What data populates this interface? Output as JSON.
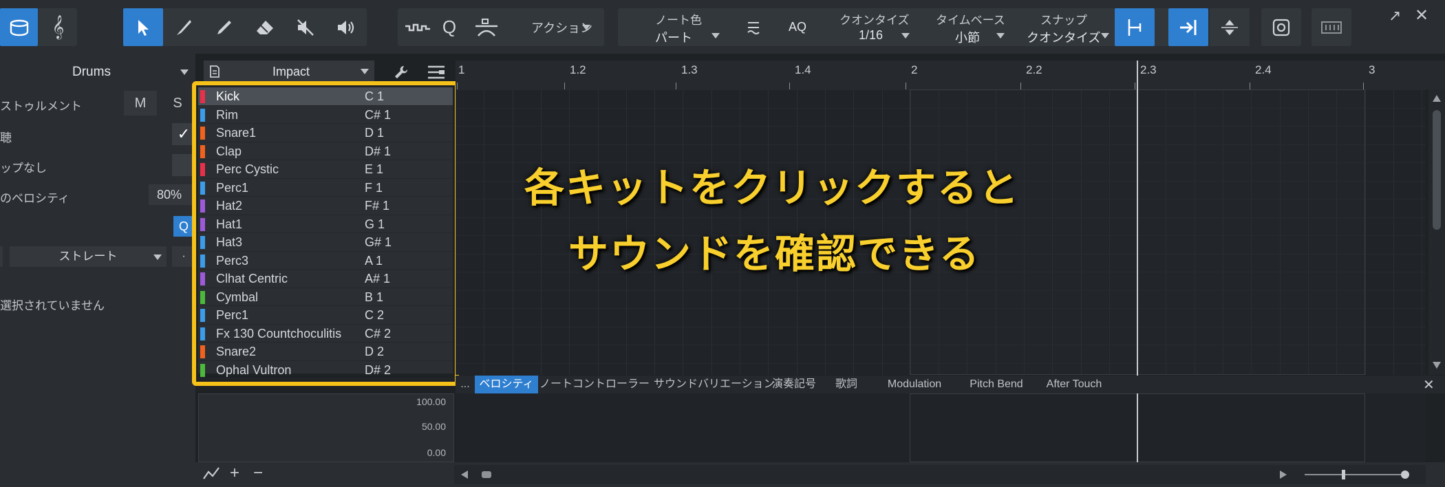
{
  "toolbar": {
    "action_label": "アクション",
    "note_color_label": "ノート色",
    "note_color_value": "パート",
    "aq_label": "AQ",
    "quantize_label": "クオンタイズ",
    "quantize_value": "1/16",
    "timebase_label": "タイムベース",
    "timebase_value": "小節",
    "snap_label": "スナップ",
    "snap_value": "クオンタイズ"
  },
  "inspector": {
    "track_name": "Drums",
    "instrument_name": "Impact",
    "instrument_label": "ストゥルメント",
    "mute_label": "M",
    "solo_label": "S",
    "preview_label": "聴",
    "snap_none_label": "ップなし",
    "velocity_label": "のベロシティ",
    "velocity_value": "80%",
    "q_label": "Q",
    "straight_label": "ストレート",
    "selection_label": "選択されていません"
  },
  "drum_list": [
    {
      "name": "Kick",
      "note": "C 1",
      "color": "#e8304a"
    },
    {
      "name": "Rim",
      "note": "C# 1",
      "color": "#3d9be9"
    },
    {
      "name": "Snare1",
      "note": "D 1",
      "color": "#f0621e"
    },
    {
      "name": "Clap",
      "note": "D# 1",
      "color": "#f0621e"
    },
    {
      "name": "Perc Cystic",
      "note": "E 1",
      "color": "#e8304a"
    },
    {
      "name": "Perc1",
      "note": "F 1",
      "color": "#3d9be9"
    },
    {
      "name": "Hat2",
      "note": "F# 1",
      "color": "#9d5ad8"
    },
    {
      "name": "Hat1",
      "note": "G 1",
      "color": "#9d5ad8"
    },
    {
      "name": "Hat3",
      "note": "G# 1",
      "color": "#3d9be9"
    },
    {
      "name": "Perc3",
      "note": "A 1",
      "color": "#3d9be9"
    },
    {
      "name": "Clhat Centric",
      "note": "A# 1",
      "color": "#9d5ad8"
    },
    {
      "name": "Cymbal",
      "note": "B 1",
      "color": "#4cb83c"
    },
    {
      "name": "Perc1",
      "note": "C 2",
      "color": "#3d9be9"
    },
    {
      "name": "Fx 130 Countchoculitis",
      "note": "C# 2",
      "color": "#3d9be9"
    },
    {
      "name": "Snare2",
      "note": "D 2",
      "color": "#f0621e"
    },
    {
      "name": "Ophal Vultron",
      "note": "D# 2",
      "color": "#4cb83c"
    }
  ],
  "ruler": [
    "1",
    "1.2",
    "1.3",
    "1.4",
    "2",
    "2.2",
    "2.3",
    "2.4",
    "3"
  ],
  "annotation": {
    "line1": "各キットをクリックすると",
    "line2": "サウンドを確認できる"
  },
  "lane_tabs": [
    "ベロシティ",
    "ノートコントローラー",
    "サウンドバリエーション",
    "演奏記号",
    "歌詞",
    "Modulation",
    "Pitch Bend",
    "After Touch"
  ],
  "more_tabs": "...",
  "velocity_scale": [
    "100.00",
    "50.00",
    "0.00"
  ],
  "colors": {
    "accent": "#2f7fd1",
    "highlight": "#f6c21a",
    "annotation": "#f8cf2c"
  }
}
